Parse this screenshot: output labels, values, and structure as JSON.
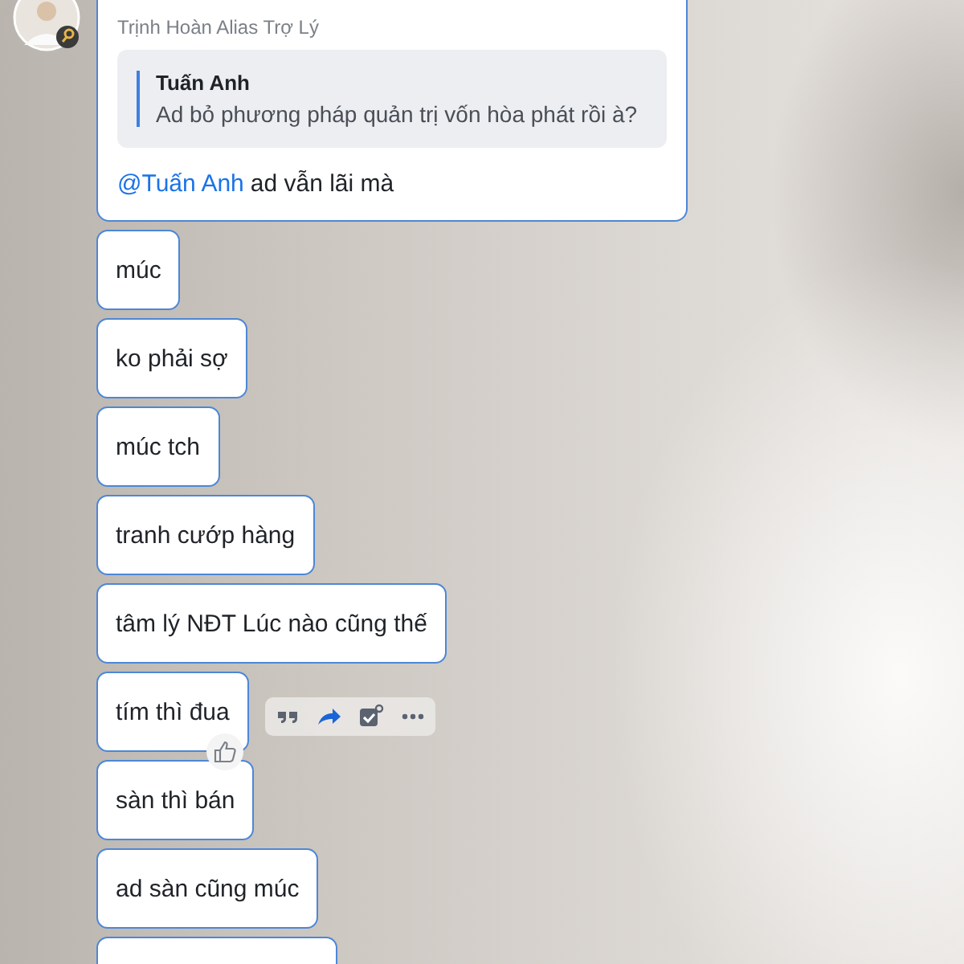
{
  "reply_card": {
    "sender": "Trịnh Hoàn Alias Trợ Lý",
    "quote": {
      "author": "Tuấn Anh",
      "text": "Ad bỏ phương pháp quản trị vốn hòa phát rồi à?"
    },
    "mention": "@Tuấn Anh",
    "text": "ad vẫn lãi mà"
  },
  "messages": [
    {
      "text": "múc",
      "hovered": false
    },
    {
      "text": "ko phải sợ",
      "hovered": false
    },
    {
      "text": "múc tch",
      "hovered": false
    },
    {
      "text": "tranh cướp hàng",
      "hovered": false
    },
    {
      "text": "tâm lý NĐT Lúc nào cũng thế",
      "hovered": false
    },
    {
      "text": "tím thì đua",
      "hovered": true
    },
    {
      "text": "sàn thì bán",
      "hovered": false
    },
    {
      "text": "ad sàn cũng múc",
      "hovered": false
    }
  ]
}
